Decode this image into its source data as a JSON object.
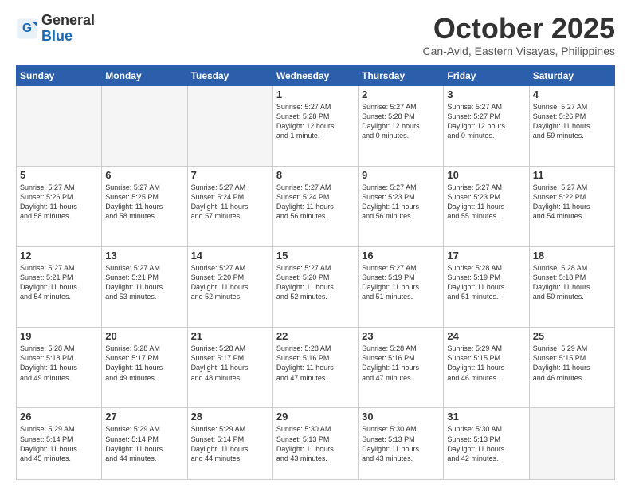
{
  "logo": {
    "general": "General",
    "blue": "Blue"
  },
  "header": {
    "month": "October 2025",
    "location": "Can-Avid, Eastern Visayas, Philippines"
  },
  "days": [
    "Sunday",
    "Monday",
    "Tuesday",
    "Wednesday",
    "Thursday",
    "Friday",
    "Saturday"
  ],
  "weeks": [
    [
      {
        "day": "",
        "info": ""
      },
      {
        "day": "",
        "info": ""
      },
      {
        "day": "",
        "info": ""
      },
      {
        "day": "1",
        "info": "Sunrise: 5:27 AM\nSunset: 5:28 PM\nDaylight: 12 hours\nand 1 minute."
      },
      {
        "day": "2",
        "info": "Sunrise: 5:27 AM\nSunset: 5:28 PM\nDaylight: 12 hours\nand 0 minutes."
      },
      {
        "day": "3",
        "info": "Sunrise: 5:27 AM\nSunset: 5:27 PM\nDaylight: 12 hours\nand 0 minutes."
      },
      {
        "day": "4",
        "info": "Sunrise: 5:27 AM\nSunset: 5:26 PM\nDaylight: 11 hours\nand 59 minutes."
      }
    ],
    [
      {
        "day": "5",
        "info": "Sunrise: 5:27 AM\nSunset: 5:26 PM\nDaylight: 11 hours\nand 58 minutes."
      },
      {
        "day": "6",
        "info": "Sunrise: 5:27 AM\nSunset: 5:25 PM\nDaylight: 11 hours\nand 58 minutes."
      },
      {
        "day": "7",
        "info": "Sunrise: 5:27 AM\nSunset: 5:24 PM\nDaylight: 11 hours\nand 57 minutes."
      },
      {
        "day": "8",
        "info": "Sunrise: 5:27 AM\nSunset: 5:24 PM\nDaylight: 11 hours\nand 56 minutes."
      },
      {
        "day": "9",
        "info": "Sunrise: 5:27 AM\nSunset: 5:23 PM\nDaylight: 11 hours\nand 56 minutes."
      },
      {
        "day": "10",
        "info": "Sunrise: 5:27 AM\nSunset: 5:23 PM\nDaylight: 11 hours\nand 55 minutes."
      },
      {
        "day": "11",
        "info": "Sunrise: 5:27 AM\nSunset: 5:22 PM\nDaylight: 11 hours\nand 54 minutes."
      }
    ],
    [
      {
        "day": "12",
        "info": "Sunrise: 5:27 AM\nSunset: 5:21 PM\nDaylight: 11 hours\nand 54 minutes."
      },
      {
        "day": "13",
        "info": "Sunrise: 5:27 AM\nSunset: 5:21 PM\nDaylight: 11 hours\nand 53 minutes."
      },
      {
        "day": "14",
        "info": "Sunrise: 5:27 AM\nSunset: 5:20 PM\nDaylight: 11 hours\nand 52 minutes."
      },
      {
        "day": "15",
        "info": "Sunrise: 5:27 AM\nSunset: 5:20 PM\nDaylight: 11 hours\nand 52 minutes."
      },
      {
        "day": "16",
        "info": "Sunrise: 5:27 AM\nSunset: 5:19 PM\nDaylight: 11 hours\nand 51 minutes."
      },
      {
        "day": "17",
        "info": "Sunrise: 5:28 AM\nSunset: 5:19 PM\nDaylight: 11 hours\nand 51 minutes."
      },
      {
        "day": "18",
        "info": "Sunrise: 5:28 AM\nSunset: 5:18 PM\nDaylight: 11 hours\nand 50 minutes."
      }
    ],
    [
      {
        "day": "19",
        "info": "Sunrise: 5:28 AM\nSunset: 5:18 PM\nDaylight: 11 hours\nand 49 minutes."
      },
      {
        "day": "20",
        "info": "Sunrise: 5:28 AM\nSunset: 5:17 PM\nDaylight: 11 hours\nand 49 minutes."
      },
      {
        "day": "21",
        "info": "Sunrise: 5:28 AM\nSunset: 5:17 PM\nDaylight: 11 hours\nand 48 minutes."
      },
      {
        "day": "22",
        "info": "Sunrise: 5:28 AM\nSunset: 5:16 PM\nDaylight: 11 hours\nand 47 minutes."
      },
      {
        "day": "23",
        "info": "Sunrise: 5:28 AM\nSunset: 5:16 PM\nDaylight: 11 hours\nand 47 minutes."
      },
      {
        "day": "24",
        "info": "Sunrise: 5:29 AM\nSunset: 5:15 PM\nDaylight: 11 hours\nand 46 minutes."
      },
      {
        "day": "25",
        "info": "Sunrise: 5:29 AM\nSunset: 5:15 PM\nDaylight: 11 hours\nand 46 minutes."
      }
    ],
    [
      {
        "day": "26",
        "info": "Sunrise: 5:29 AM\nSunset: 5:14 PM\nDaylight: 11 hours\nand 45 minutes."
      },
      {
        "day": "27",
        "info": "Sunrise: 5:29 AM\nSunset: 5:14 PM\nDaylight: 11 hours\nand 44 minutes."
      },
      {
        "day": "28",
        "info": "Sunrise: 5:29 AM\nSunset: 5:14 PM\nDaylight: 11 hours\nand 44 minutes."
      },
      {
        "day": "29",
        "info": "Sunrise: 5:30 AM\nSunset: 5:13 PM\nDaylight: 11 hours\nand 43 minutes."
      },
      {
        "day": "30",
        "info": "Sunrise: 5:30 AM\nSunset: 5:13 PM\nDaylight: 11 hours\nand 43 minutes."
      },
      {
        "day": "31",
        "info": "Sunrise: 5:30 AM\nSunset: 5:13 PM\nDaylight: 11 hours\nand 42 minutes."
      },
      {
        "day": "",
        "info": ""
      }
    ]
  ]
}
